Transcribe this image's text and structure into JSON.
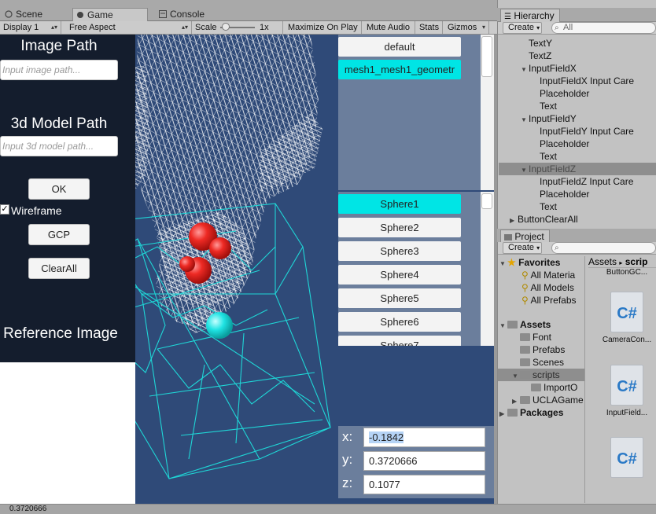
{
  "tabs": [
    {
      "label": "Scene",
      "icon": "scene-icon"
    },
    {
      "label": "Game",
      "icon": "game-icon"
    },
    {
      "label": "Console",
      "icon": "console-icon"
    }
  ],
  "game_toolbar": {
    "display": "Display 1",
    "aspect": "Free Aspect",
    "scale_label": "Scale",
    "scale_value": "1x",
    "maximize": "Maximize On Play",
    "mute": "Mute Audio",
    "stats": "Stats",
    "gizmos": "Gizmos"
  },
  "ui": {
    "image_path_title": "Image Path",
    "image_path_placeholder": "Input image path...",
    "model_path_title": "3d Model Path",
    "model_path_placeholder": "Input 3d model path...",
    "ok_label": "OK",
    "wireframe_label": "Wireframe",
    "wireframe_checked": "✓",
    "gcp_label": "GCP",
    "clearall_label": "ClearAll",
    "reference_label": "Reference Image"
  },
  "mesh_list": {
    "items": [
      "default",
      "mesh1_mesh1_geometr"
    ],
    "selected_index": 1
  },
  "sphere_list": {
    "items": [
      "Sphere1",
      "Sphere2",
      "Sphere3",
      "Sphere4",
      "Sphere5",
      "Sphere6",
      "Sphere7"
    ],
    "selected_index": 0
  },
  "coords": {
    "x_label": "x:",
    "x_value": "-0.1842",
    "y_label": "y:",
    "y_value": "0.3720666",
    "z_label": "z:",
    "z_value": "0.1077"
  },
  "hierarchy": {
    "title": "Hierarchy",
    "create": "Create",
    "search_placeholder": "All",
    "rows": [
      {
        "label": "TextY",
        "indent": 3,
        "expand": ""
      },
      {
        "label": "TextZ",
        "indent": 3,
        "expand": ""
      },
      {
        "label": "InputFieldX",
        "indent": 3,
        "expand": "▼"
      },
      {
        "label": "InputFieldX Input Care",
        "indent": 4,
        "expand": ""
      },
      {
        "label": "Placeholder",
        "indent": 4,
        "expand": ""
      },
      {
        "label": "Text",
        "indent": 4,
        "expand": ""
      },
      {
        "label": "InputFieldY",
        "indent": 3,
        "expand": "▼"
      },
      {
        "label": "InputFieldY Input Care",
        "indent": 4,
        "expand": ""
      },
      {
        "label": "Placeholder",
        "indent": 4,
        "expand": ""
      },
      {
        "label": "Text",
        "indent": 4,
        "expand": ""
      },
      {
        "label": "InputFieldZ",
        "indent": 3,
        "expand": "▼",
        "selected": true
      },
      {
        "label": "InputFieldZ Input Care",
        "indent": 4,
        "expand": ""
      },
      {
        "label": "Placeholder",
        "indent": 4,
        "expand": ""
      },
      {
        "label": "Text",
        "indent": 4,
        "expand": ""
      },
      {
        "label": "ButtonClearAll",
        "indent": 2,
        "expand": "▶"
      }
    ]
  },
  "project": {
    "title": "Project",
    "create": "Create",
    "favorites_label": "Favorites",
    "favorites": [
      "All Materia",
      "All Models",
      "All Prefabs"
    ],
    "assets_label": "Assets",
    "folders": [
      "Font",
      "Prefabs",
      "Scenes",
      "scripts",
      "ImportO",
      "UCLAGame"
    ],
    "packages_label": "Packages",
    "breadcrumb": "Assets",
    "breadcrumb_child": "scrip",
    "top_item": "ButtonGC...",
    "assets": [
      {
        "name": "CameraCon...",
        "icon": "C#"
      },
      {
        "name": "InputField...",
        "icon": "C#"
      },
      {
        "name": "",
        "icon": "C#"
      }
    ]
  },
  "status": {
    "text": "0.3720666"
  },
  "colors": {
    "game_bg": "#2f4a78",
    "highlight": "#00e5e5",
    "wire_white": "#ffffff",
    "wire_cyan": "#1fd6d6",
    "sphere_red": "#e8201c"
  }
}
